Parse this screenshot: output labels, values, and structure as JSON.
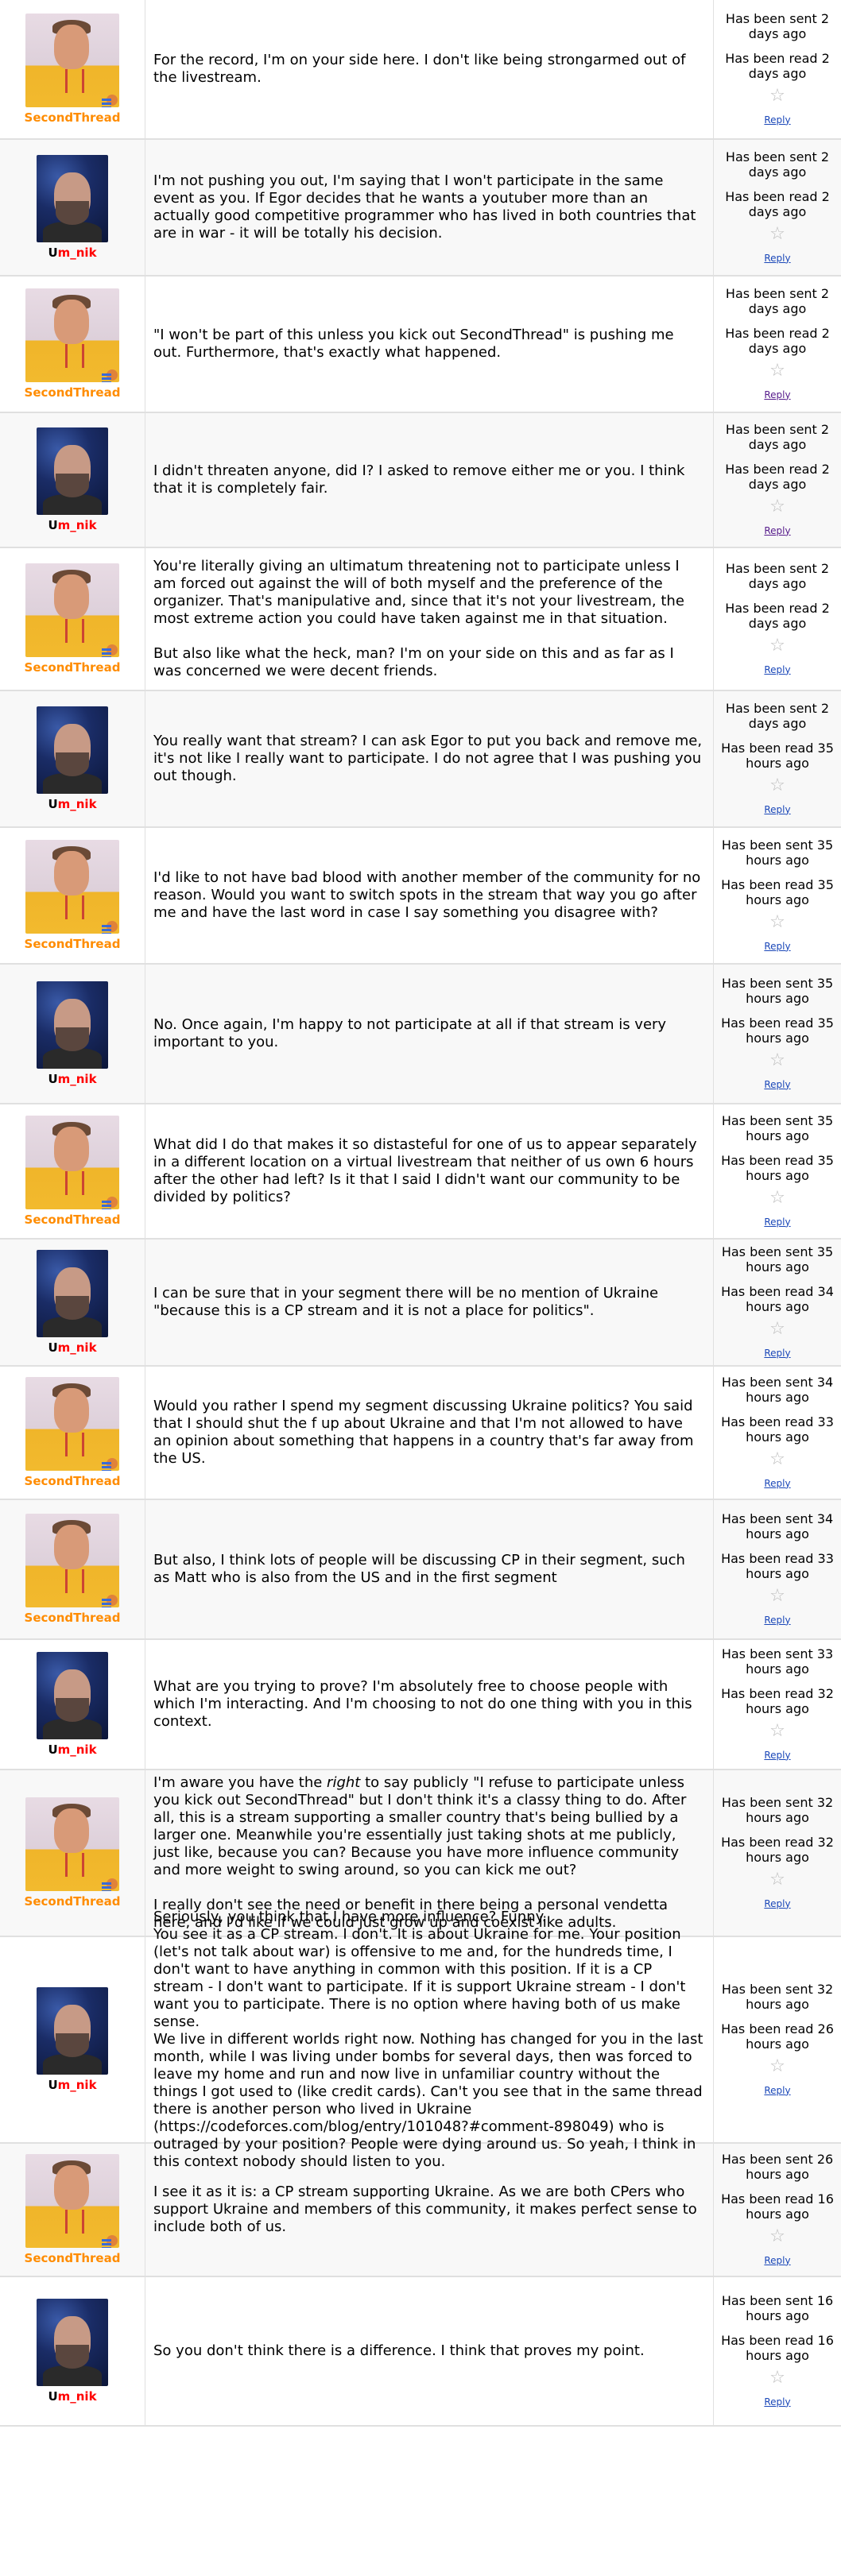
{
  "messages": [
    {
      "author": "SecondThread",
      "text": "For the record, I'm on your side here. I don't like being strongarmed out of the livestream.",
      "sent": "Has been sent 2 days ago",
      "read": "Has been read 2 days ago",
      "reply": "Reply"
    },
    {
      "author": "Um_nik",
      "text": "I'm not pushing you out, I'm saying that I won't participate in the same event as you. If Egor decides that he wants a youtuber more than an actually good competitive programmer who has lived in both countries that are in war - it will be totally his decision.",
      "sent": "Has been sent 2 days ago",
      "read": "Has been read 2 days ago",
      "reply": "Reply"
    },
    {
      "author": "SecondThread",
      "text": "\"I won't be part of this unless you kick out SecondThread\" is pushing me out. Furthermore, that's exactly what happened.",
      "sent": "Has been sent 2 days ago",
      "read": "Has been read 2 days ago",
      "reply": "Reply"
    },
    {
      "author": "Um_nik",
      "text": "I didn't threaten anyone, did I? I asked to remove either me or you. I think that it is completely fair.",
      "sent": "Has been sent 2 days ago",
      "read": "Has been read 2 days ago",
      "reply": "Reply"
    },
    {
      "author": "SecondThread",
      "text": "You're literally giving an ultimatum threatening not to participate unless I am forced out against the will of both myself and the preference of the organizer. That's manipulative and, since that it's not your livestream, the most extreme action you could have taken against me in that situation.\n\nBut also like what the heck, man? I'm on your side on this and as far as I was concerned we were decent friends.",
      "sent": "Has been sent 2 days ago",
      "read": "Has been read 2 days ago",
      "reply": "Reply"
    },
    {
      "author": "Um_nik",
      "text": "You really want that stream? I can ask Egor to put you back and remove me, it's not like I really want to participate. I do not agree that I was pushing you out though.",
      "sent": "Has been sent 2 days ago",
      "read": "Has been read 35 hours ago",
      "reply": "Reply"
    },
    {
      "author": "SecondThread",
      "text": "I'd like to not have bad blood with another member of the community for no reason. Would you want to switch spots in the stream that way you go after me and have the last word in case I say something you disagree with?",
      "sent": "Has been sent 35 hours ago",
      "read": "Has been read 35 hours ago",
      "reply": "Reply"
    },
    {
      "author": "Um_nik",
      "text": "No. Once again, I'm happy to not participate at all if that stream is very important to you.",
      "sent": "Has been sent 35 hours ago",
      "read": "Has been read 35 hours ago",
      "reply": "Reply"
    },
    {
      "author": "SecondThread",
      "text": "What did I do that makes it so distasteful for one of us to appear separately in a different location on a virtual livestream that neither of us own 6 hours after the other had left? Is it that I said I didn't want our community to be divided by politics?",
      "sent": "Has been sent 35 hours ago",
      "read": "Has been read 35 hours ago",
      "reply": "Reply"
    },
    {
      "author": "Um_nik",
      "text": "I can be sure that in your segment there will be no mention of Ukraine \"because this is a CP stream and it is not a place for politics\".",
      "sent": "Has been sent 35 hours ago",
      "read": "Has been read 34 hours ago",
      "reply": "Reply"
    },
    {
      "author": "SecondThread",
      "text": "Would you rather I spend my segment discussing Ukraine politics? You said that I should shut the f up about Ukraine and that I'm not allowed to have an opinion about something that happens in a country that's far away from the US.",
      "sent": "Has been sent 34 hours ago",
      "read": "Has been read 33 hours ago",
      "reply": "Reply"
    },
    {
      "author": "SecondThread",
      "text": "But also, I think lots of people will be discussing CP in their segment, such as Matt who is also from the US and in the first segment",
      "sent": "Has been sent 34 hours ago",
      "read": "Has been read 33 hours ago",
      "reply": "Reply"
    },
    {
      "author": "Um_nik",
      "text": "What are you trying to prove? I'm absolutely free to choose people with which I'm interacting. And I'm choosing to not do one thing with you in this context.",
      "sent": "Has been sent 33 hours ago",
      "read": "Has been read 32 hours ago",
      "reply": "Reply"
    },
    {
      "author": "SecondThread",
      "text_pre": "I'm aware you have the ",
      "text_em": "right",
      "text_post": " to say publicly \"I refuse to participate unless you kick out SecondThread\" but I don't think it's a classy thing to do. After all, this is a stream supporting a smaller country that's being bullied by a larger one. Meanwhile you're essentially just taking shots at me publicly, just like, because you can? Because you have more influence community and more weight to swing around, so you can kick me out?\n\nI really don't see the need or benefit in there being a personal vendetta here, and I'd like if we could just grow up and coexist like adults.",
      "sent": "Has been sent 32 hours ago",
      "read": "Has been read 32 hours ago",
      "reply": "Reply"
    },
    {
      "author": "Um_nik",
      "text": "Seriously, you think that I have more influence? Funny.\nYou see it as a CP stream. I don't. It is about Ukraine for me. Your position (let's not talk about war) is offensive to me and, for the hundreds time, I don't want to have anything in common with this position. If it is a CP stream - I don't want to participate. If it is support Ukraine stream - I don't want you to participate. There is no option where having both of us make sense.\nWe live in different worlds right now. Nothing has changed for you in the last month, while I was living under bombs for several days, then was forced to leave my home and run and now live in unfamiliar country without the things I got used to (like credit cards). Can't you see that in the same thread there is another person who lived in Ukraine (https://codeforces.com/blog/entry/101048?#comment-898049) who is outraged by your position? People were dying around us. So yeah, I think in this context nobody should listen to you.",
      "sent": "Has been sent 32 hours ago",
      "read": "Has been read 26 hours ago",
      "reply": "Reply"
    },
    {
      "author": "SecondThread",
      "text": "I see it as it is: a CP stream supporting Ukraine. As we are both CPers who support Ukraine and members of this community, it makes perfect sense to include both of us.",
      "sent": "Has been sent 26 hours ago",
      "read": "Has been read 16 hours ago",
      "reply": "Reply"
    },
    {
      "author": "Um_nik",
      "text": "So you don't think there is a difference. I think that proves my point.",
      "sent": "Has been sent 16 hours ago",
      "read": "Has been read 16 hours ago",
      "reply": "Reply"
    }
  ],
  "handles": {
    "st": "SecondThread",
    "mn_first": "U",
    "mn_rest": "m_nik"
  },
  "colors": {
    "second_thread": "#ff8c00",
    "um_nik": "#ff0000",
    "reply_link": "#1a47b8"
  },
  "icons": {
    "star": "star-outline-icon",
    "rank": "rank-badge-icon"
  }
}
